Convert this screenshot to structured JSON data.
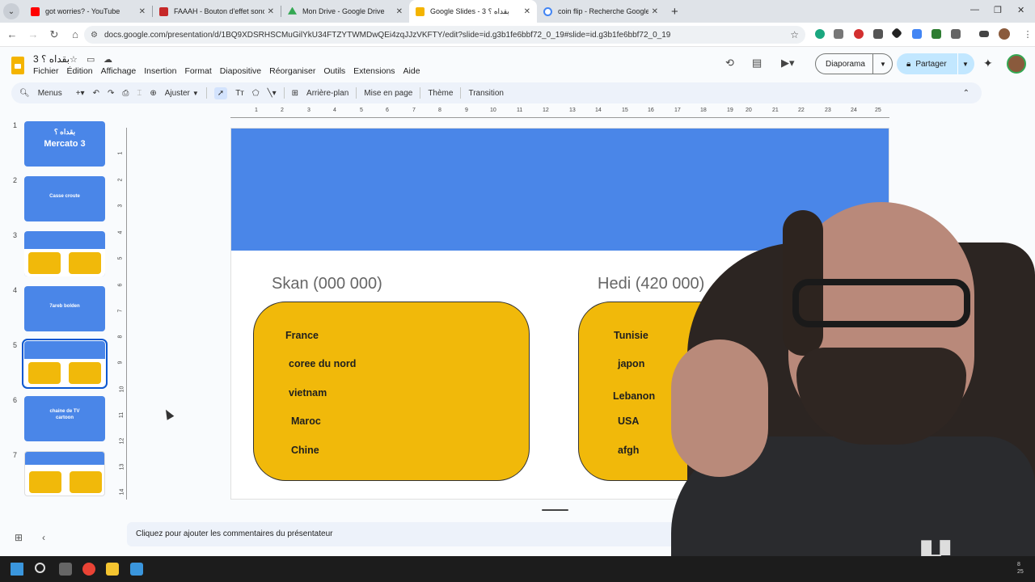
{
  "browser": {
    "tabs": [
      {
        "title": "got worries? - YouTube",
        "favicon_color": "#ff0000",
        "active": false
      },
      {
        "title": "FAAAH - Bouton d'effet sonore",
        "favicon_color": "#c62828",
        "active": false
      },
      {
        "title": "Mon Drive - Google Drive",
        "favicon_color": "#34a853",
        "active": false
      },
      {
        "title": "Google Slides - بقداه ؟ 3",
        "favicon_color": "#f4b400",
        "active": true
      },
      {
        "title": "coin flip - Recherche Google",
        "favicon_color": "#4285f4",
        "active": false
      }
    ],
    "url": "docs.google.com/presentation/d/1BQ9XDSRHSCMuGilYkU34FTZYTWMDwQEi4zqJJzVKFTY/edit?slide=id.g3b1fe6bbf72_0_19#slide=id.g3b1fe6bbf72_0_19"
  },
  "doc": {
    "title": "بقداه ؟ 3",
    "menu": [
      "Fichier",
      "Édition",
      "Affichage",
      "Insertion",
      "Format",
      "Diapositive",
      "Réorganiser",
      "Outils",
      "Extensions",
      "Aide"
    ],
    "present_label": "Diaporama",
    "share_label": "Partager"
  },
  "toolbar": {
    "menus_label": "Menus",
    "zoom_label": "Ajuster",
    "background_label": "Arrière-plan",
    "layout_label": "Mise en page",
    "theme_label": "Thème",
    "transition_label": "Transition"
  },
  "ruler": {
    "h": [
      "1",
      "2",
      "3",
      "4",
      "5",
      "6",
      "7",
      "8",
      "9",
      "10",
      "11",
      "12",
      "13",
      "14",
      "15",
      "16",
      "17",
      "18",
      "19",
      "20",
      "21",
      "22",
      "23",
      "24",
      "25"
    ],
    "v": [
      "1",
      "2",
      "3",
      "4",
      "5",
      "6",
      "7",
      "8",
      "9",
      "10",
      "11",
      "12",
      "13",
      "14"
    ]
  },
  "filmstrip": [
    {
      "num": "1",
      "line1": "بقداه ؟",
      "line2": "Mercato 3"
    },
    {
      "num": "2",
      "line1": "Casse croute"
    },
    {
      "num": "3"
    },
    {
      "num": "4",
      "line1": "7areb bolden"
    },
    {
      "num": "5"
    },
    {
      "num": "6",
      "line1": "chaine de TV",
      "line2": "cartoon"
    },
    {
      "num": "7"
    }
  ],
  "slide": {
    "left_title": "Skan (000 000)",
    "right_title": "Hedi (420 000)",
    "left_items": [
      "France",
      "coree du nord",
      "vietnam",
      "Maroc",
      "Chine"
    ],
    "right_items": [
      "Tunisie",
      "japon",
      "Lebanon",
      "USA",
      "afgh"
    ],
    "banner_color": "#4a86e8",
    "card_color": "#f1b90a"
  },
  "notes_placeholder": "Cliquez pour ajouter les commentaires du présentateur",
  "tray_time": "8\n25"
}
